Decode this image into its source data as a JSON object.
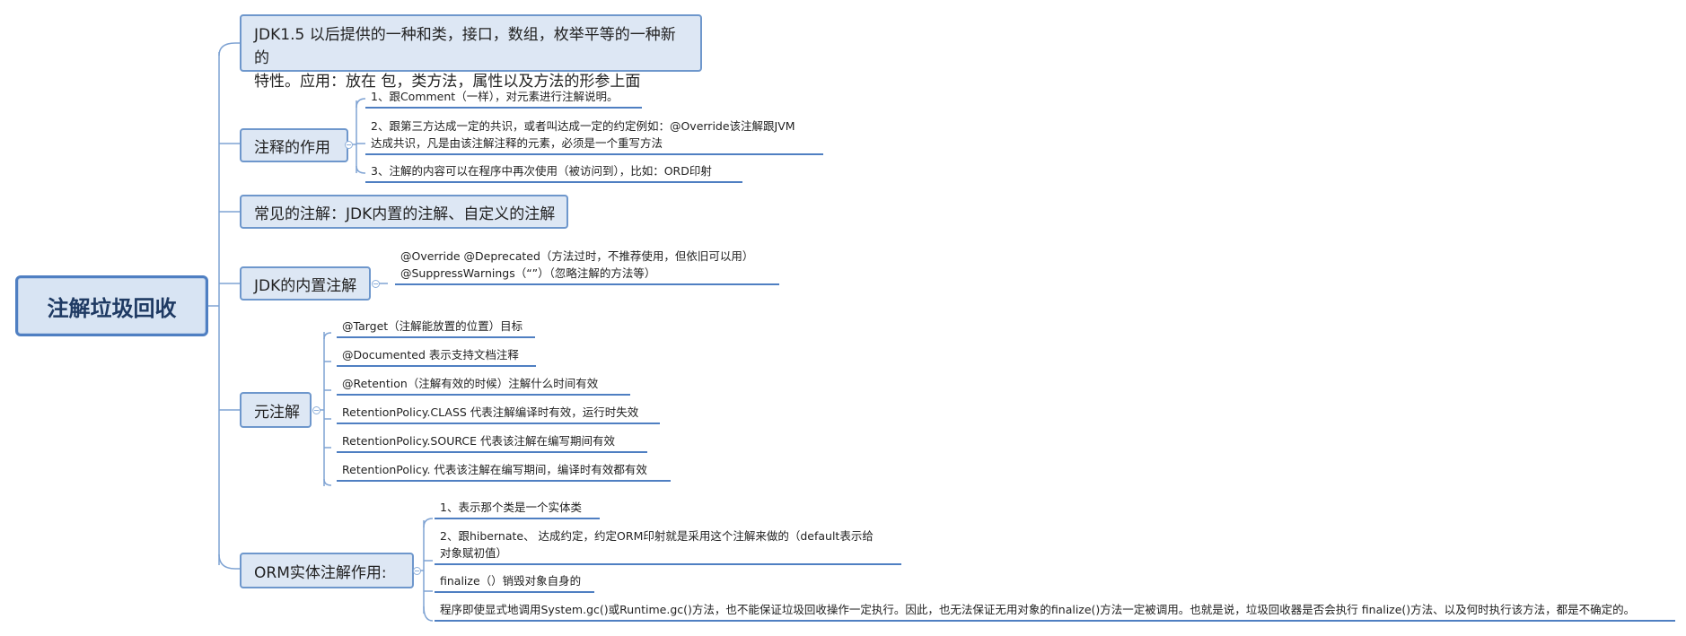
{
  "root": {
    "label": "注解垃圾回收"
  },
  "branches": [
    {
      "label": "JDK1.5 以后提供的一种和类，接口，数组，枚举平等的一种新的",
      "label2": "特性。应用：放在 包，类方法，属性以及方法的形参上面"
    },
    {
      "label": "注释的作用",
      "children": [
        {
          "text": "1、跟Comment（一样），对元素进行注解说明。"
        },
        {
          "text": "2、跟第三方达成一定的共识，或者叫达成一定的约定例如：@Override该注解跟JVM",
          "text2": "达成共识，凡是由该注解注释的元素，必须是一个重写方法"
        },
        {
          "text": "3、注解的内容可以在程序中再次使用（被访问到），比如：ORD印射"
        }
      ]
    },
    {
      "label": "常见的注解：JDK内置的注解、自定义的注解"
    },
    {
      "label": "JDK的内置注解",
      "children": [
        {
          "text": "@Override @Deprecated（方法过时，不推荐使用，但依旧可以用）",
          "text2": "@SuppressWarnings（“”）（忽略注解的方法等）"
        }
      ]
    },
    {
      "label": "元注解",
      "children": [
        {
          "text": "@Target（注解能放置的位置）目标"
        },
        {
          "text": "@Documented  表示支持文档注释"
        },
        {
          "text": "@Retention（注解有效的时候）注解什么时间有效"
        },
        {
          "text": "RetentionPolicy.CLASS  代表注解编译时有效，运行时失效"
        },
        {
          "text": "RetentionPolicy.SOURCE  代表该注解在编写期间有效"
        },
        {
          "text": "RetentionPolicy. 代表该注解在编写期间，编译时有效都有效"
        }
      ]
    },
    {
      "label": "ORM实体注解作用:",
      "children": [
        {
          "text": "1、表示那个类是一个实体类"
        },
        {
          "text": "2、跟hibernate、 达成约定，约定ORM印射就是采用这个注解来做的（default表示给",
          "text2": "对象赋初值）"
        },
        {
          "text": "finalize（）销毁对象自身的"
        },
        {
          "text": "程序即使显式地调用System.gc()或Runtime.gc()方法，也不能保证垃圾回收操作一定执行。因此，也无法保证无用对象的finalize()方法一定被调用。也就是说，垃圾回收器是否会执行 finalize()方法、以及何时执行该方法，都是不确定的。"
        }
      ]
    }
  ]
}
